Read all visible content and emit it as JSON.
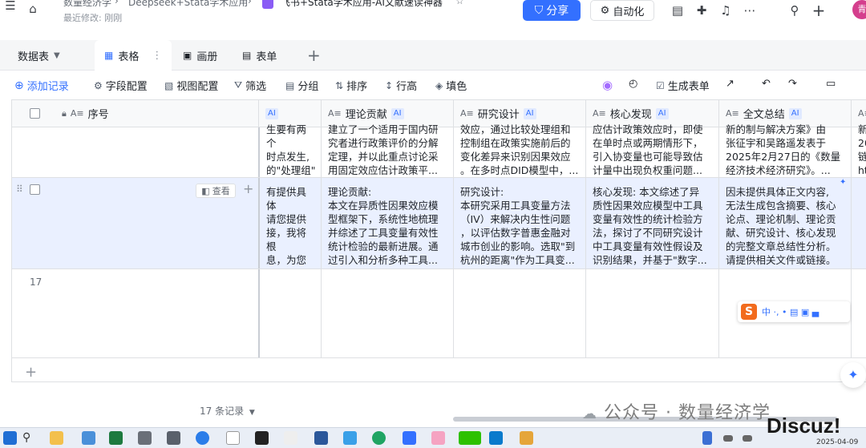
{
  "header": {
    "breadcrumb_1": "数量经济学",
    "breadcrumb_2": "Deepseek+Stata学术应用",
    "doc_title": "飞书+Stata学术应用-AI文献速读神器",
    "last_modified": "最近修改: 刚刚",
    "share_label": "分享",
    "automation_label": "自动化",
    "avatar_text": "青"
  },
  "views": {
    "table_switch": "数据表",
    "tabs": [
      {
        "label": "表格"
      },
      {
        "label": "画册"
      },
      {
        "label": "表单"
      }
    ],
    "add_symbol": "+"
  },
  "toolbar": {
    "add_record": "添加记录",
    "field_config": "字段配置",
    "view_config": "视图配置",
    "filter": "筛选",
    "group": "分组",
    "sort": "排序",
    "row_height": "行高",
    "fill_color": "填色",
    "generate_form": "生成表单"
  },
  "columns": {
    "seq": "序号",
    "theory": "理论贡献",
    "design": "研究设计",
    "finding": "核心发现",
    "summary": "全文总结",
    "ai": "AI",
    "field_type": "A≡"
  },
  "rows": [
    {
      "col_a": "生要有两个\n时点发生,\n的\"处理组\"\n所变化，从...",
      "theory": "建立了一个适用于国内研\n究者进行政策评价的分解\n定理，并以此重点讨论采\n用固定效应估计政策平...",
      "design": "效应，通过比较处理组和\n控制组在政策实施前后的\n变化差异来识别因果效应\n。在多时点DID模型中，...",
      "finding": "应估计政策效应时，即使\n在单时点或两期情形下，\n引入协变量也可能导致估\n计量中出现负权重问题...",
      "summary": "新的制与解决方案》由\n张征宇和吴路遥发表于\n2025年2月27日的《数量\n经济技术经济研究》。...",
      "extra": "新\n20\n链\nht"
    },
    {
      "view_label": "查看",
      "col_a": "有提供具体\n请您提供\n接，我将根\n息，为您撰\n述。",
      "theory": "理论贡献:\n本文在异质性因果效应模\n型框架下，系统性地梳理\n并综述了工具变量有效性\n统计检验的最新进展。通\n过引入和分析多种工具...",
      "design": "研究设计:\n本研究采用工具变量方法\n（IV）来解决内生性问题\n，以评估数字普惠金融对\n城市创业的影响。选取\"到\n杭州的距离\"作为工具变...",
      "finding": "核心发现: 本文综述了异\n质性因果效应模型中工具\n变量有效性的统计检验方\n法，探讨了不同研究设计\n中工具变量有效性假设及\n识别结果，并基于\"数字...",
      "summary": "因未提供具体正文内容,\n无法生成包含摘要、核心\n论点、理论机制、理论贡\n献、研究设计、核心发现\n的完整文章总结性分析。\n请提供相关文件或链接。"
    },
    {
      "seq": "17"
    }
  ],
  "footer": {
    "record_count": "17 条记录",
    "add_row": "+",
    "watermark": "公众号 · 数量经济学"
  },
  "ime": {
    "logo": "S",
    "text": "中 ·, • ▤ ▣ ▄"
  },
  "taskbar": {
    "site_logo": "Discuz!",
    "date": "2025-04-09"
  },
  "colors": {
    "accent": "#3370ff",
    "selected_row": "#eaf0ff",
    "grid_line": "#dee0e3"
  }
}
